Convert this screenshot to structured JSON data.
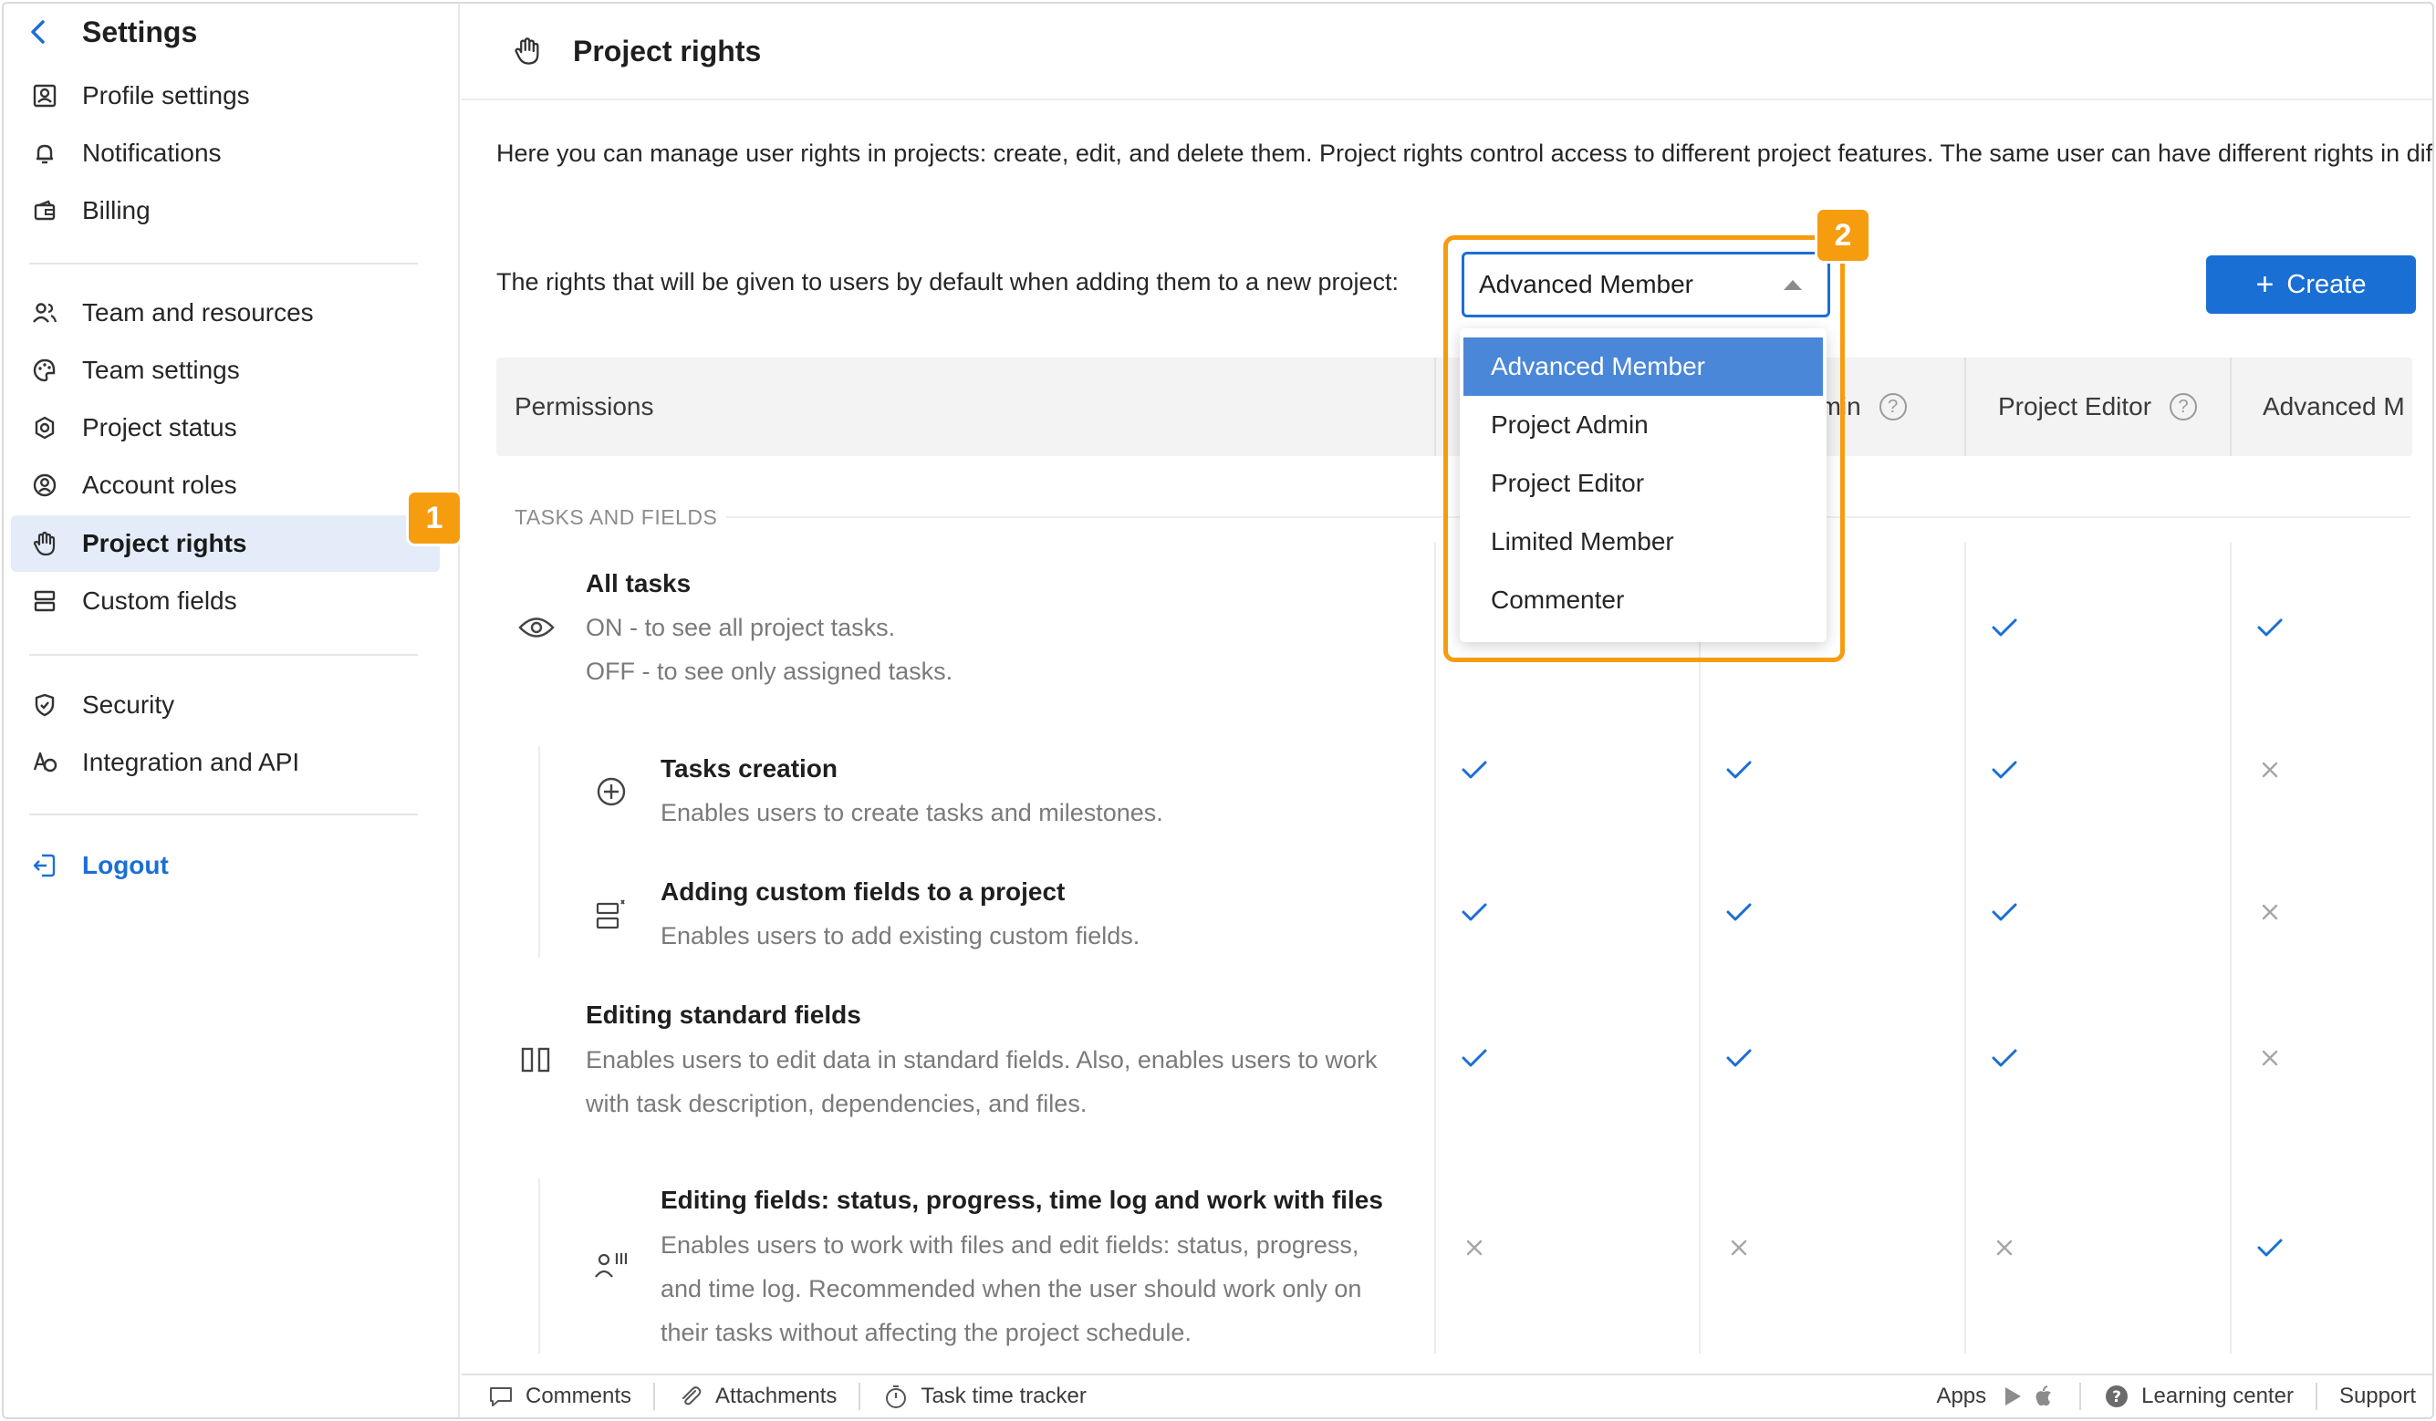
{
  "sidebar": {
    "title": "Settings",
    "items": [
      {
        "label": "Profile settings",
        "icon": "profile-icon"
      },
      {
        "label": "Notifications",
        "icon": "bell-icon"
      },
      {
        "label": "Billing",
        "icon": "wallet-icon"
      },
      {
        "label": "Team and resources",
        "icon": "team-icon"
      },
      {
        "label": "Team settings",
        "icon": "palette-icon"
      },
      {
        "label": "Project status",
        "icon": "status-icon"
      },
      {
        "label": "Account roles",
        "icon": "user-circle-icon"
      },
      {
        "label": "Project rights",
        "icon": "hand-icon"
      },
      {
        "label": "Custom fields",
        "icon": "fields-icon"
      },
      {
        "label": "Security",
        "icon": "shield-icon"
      },
      {
        "label": "Integration and API",
        "icon": "integration-icon"
      }
    ],
    "logout_label": "Logout",
    "active_item": "Project rights"
  },
  "badges": {
    "one": "1",
    "two": "2"
  },
  "header": {
    "title": "Project rights"
  },
  "content": {
    "description": "Here you can manage user rights in projects: create, edit, and delete them. Project rights control access to different project features. The same user can have different rights in different projects.",
    "default_rights_label": "The rights that will be given to users by default when adding them to a new project:",
    "default_select_value": "Advanced Member",
    "dropdown_options": [
      "Advanced Member",
      "Project Admin",
      "Project Editor",
      "Limited Member",
      "Commenter"
    ],
    "create_label": "Create"
  },
  "table": {
    "permissions_header": "Permissions",
    "columns": [
      "Project Admin",
      "Project Editor",
      "Advanced M"
    ],
    "col_partial_visible": "dmin",
    "section_label": "TASKS AND FIELDS",
    "rows": [
      {
        "title": "All tasks",
        "desc": [
          "ON - to see all project tasks.",
          "OFF - to see only assigned tasks."
        ],
        "icon": "eye-icon",
        "marks": [
          "hidden",
          "hidden",
          "check",
          "check"
        ]
      },
      {
        "title": "Tasks creation",
        "desc": [
          "Enables users to create tasks and milestones."
        ],
        "icon": "plus-circle-icon",
        "marks": [
          "check",
          "check",
          "check",
          "cross"
        ]
      },
      {
        "title": "Adding custom fields to a project",
        "desc": [
          "Enables users to add existing custom fields."
        ],
        "icon": "custom-field-icon",
        "marks": [
          "check",
          "check",
          "check",
          "cross"
        ]
      },
      {
        "title": "Editing standard fields",
        "desc": [
          "Enables users to edit data in standard fields. Also, enables users to work",
          "with task description, dependencies, and files."
        ],
        "icon": "columns-icon",
        "marks": [
          "check",
          "check",
          "check",
          "cross"
        ]
      },
      {
        "title": "Editing fields: status, progress, time log and work with files",
        "desc": [
          "Enables users to work with files and edit fields: status, progress,",
          "and time log. Recommended when the user should work only on",
          "their tasks without affecting the project schedule."
        ],
        "icon": "user-bars-icon",
        "marks": [
          "cross",
          "cross",
          "cross",
          "check"
        ]
      }
    ]
  },
  "footer": {
    "comments": "Comments",
    "attachments": "Attachments",
    "time_tracker": "Task time tracker",
    "apps": "Apps",
    "learning": "Learning center",
    "support": "Support"
  },
  "colors": {
    "accent": "#1a6fd4",
    "highlight": "#f59d0f",
    "active_bg": "#e3ecf8",
    "check": "#1a6fd4",
    "cross": "#a6a6a6"
  }
}
